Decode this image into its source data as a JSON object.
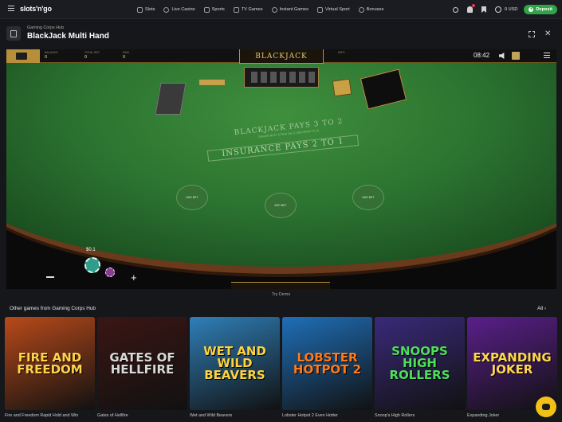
{
  "header": {
    "logo": "slots'n'go",
    "nav": [
      {
        "label": "Slots",
        "icon": "slot-icon"
      },
      {
        "label": "Live Casino",
        "icon": "live-icon"
      },
      {
        "label": "Sports",
        "icon": "sports-icon"
      },
      {
        "label": "TV Games",
        "icon": "tv-icon"
      },
      {
        "label": "Instant Games",
        "icon": "rocket-icon"
      },
      {
        "label": "Virtual Sport",
        "icon": "virtual-icon"
      },
      {
        "label": "Bonuses",
        "icon": "gift-icon"
      }
    ],
    "balance": "0 USD",
    "deposit_label": "Deposit",
    "colors": {
      "deposit": "#2fa547",
      "notification": "#e03c3c"
    }
  },
  "game": {
    "provider": "Gaming Corps Hub",
    "title": "BlackJack Multi Hand",
    "hud": {
      "balance_label": "BALANCE",
      "balance_value": "0",
      "total_bet_label": "TOTAL BET",
      "total_bet_value": "0",
      "paid_label": "PAID",
      "paid_value": "0",
      "info_label": "INFO",
      "clock": "08:42"
    },
    "logo_text": "BLACKJACK",
    "felt": {
      "line1": "BLACKJACK PAYS 3 TO 2",
      "line2": "DEALER MUST STAND ON 17 AND DRAW TO 16",
      "line3": "INSURANCE PAYS 2 TO 1"
    },
    "bet_spots": [
      "ADD BET",
      "ADD BET",
      "ADD BET"
    ],
    "chip_value": "$0.1",
    "felt_color": "#2b7230"
  },
  "try_demo": "Try Demo",
  "other_games": {
    "title": "Other games from Gaming Corps Hub",
    "all_label": "All",
    "items": [
      {
        "caption": "Fire and Freedom Rapid Hold and Win",
        "art": "FIRE AND FREEDOM",
        "bg": "#b84a1a",
        "fg": "#ffd24a"
      },
      {
        "caption": "Gates of Hellfire",
        "art": "GATES OF HELLFIRE",
        "bg": "#3a1614",
        "fg": "#d9d9d9"
      },
      {
        "caption": "Wet and Wild Beavers",
        "art": "WET AND WILD BEAVERS",
        "bg": "#2f7fb8",
        "fg": "#ffd33d"
      },
      {
        "caption": "Lobster Hotpot 2 Even Hotter",
        "art": "LOBSTER HOTPOT 2",
        "bg": "#1f6fb8",
        "fg": "#ff7a1a"
      },
      {
        "caption": "Snoop's High Rollers",
        "art": "SNOOPS HIGH ROLLERS",
        "bg": "#3a2a7a",
        "fg": "#4de05a"
      },
      {
        "caption": "Expanding Joker",
        "art": "EXPANDING JOKER",
        "bg": "#5a1f8a",
        "fg": "#ffd84a"
      }
    ]
  }
}
